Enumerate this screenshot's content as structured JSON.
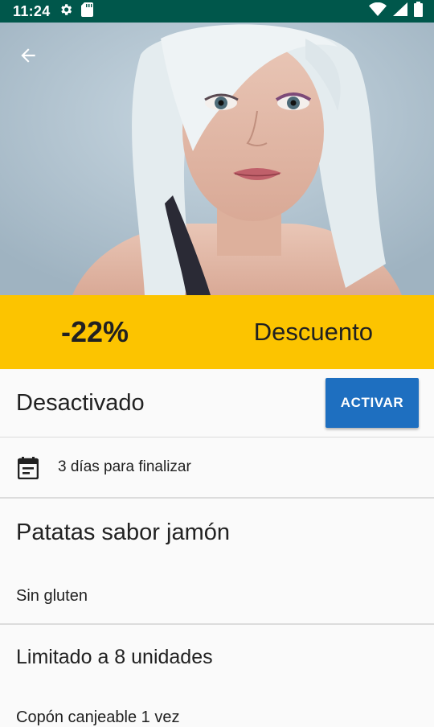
{
  "status_bar": {
    "time": "11:24",
    "icons_left": [
      "settings-icon",
      "sd-card-icon"
    ],
    "icons_right": [
      "wifi-icon",
      "signal-icon",
      "battery-icon"
    ],
    "background": "#00574b"
  },
  "hero": {
    "back_icon": "arrow-back-icon"
  },
  "discount": {
    "value": "-22%",
    "label": "Descuento",
    "background": "#fcc400"
  },
  "activation": {
    "status": "Desactivado",
    "button_label": "ACTIVAR",
    "button_color": "#1e6fc0"
  },
  "deadline": {
    "icon": "calendar-icon",
    "text": "3 días para finalizar"
  },
  "product": {
    "name": "Patatas sabor jamón",
    "subtitle": "Sin gluten"
  },
  "limits": {
    "title": "Limitado a 8 unidades",
    "coupon": "Copón canjeable 1 vez"
  }
}
